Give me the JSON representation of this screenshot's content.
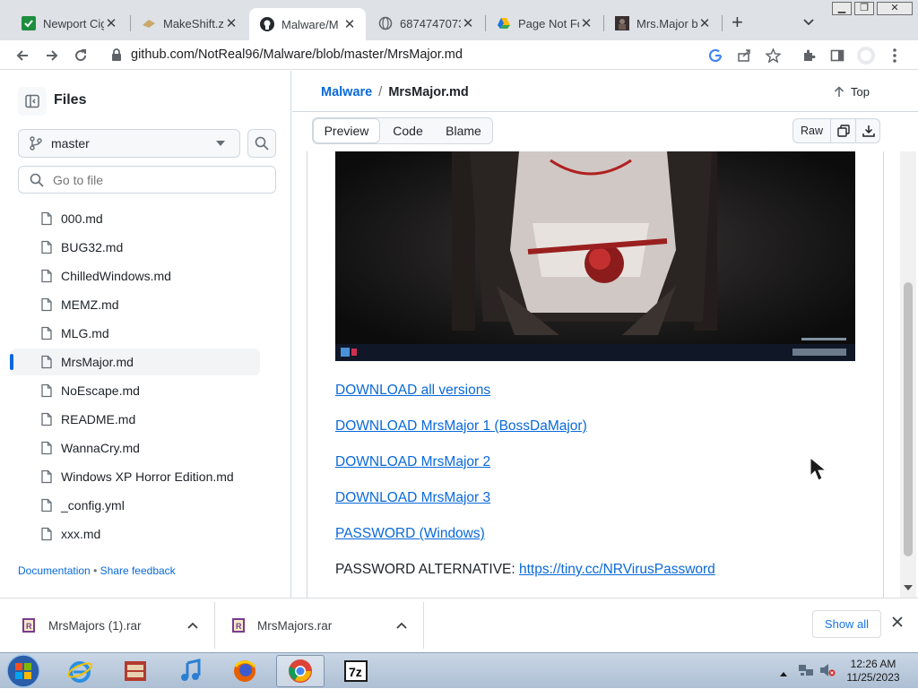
{
  "browser": {
    "tabs": [
      {
        "title": "Newport Cig",
        "favicon": "newport-favicon"
      },
      {
        "title": "MakeShift.zi",
        "favicon": "makeshift-favicon"
      },
      {
        "title": "Malware/M",
        "favicon": "github-favicon",
        "active": true
      },
      {
        "title": "6874747073",
        "favicon": "globe-favicon"
      },
      {
        "title": "Page Not Fo",
        "favicon": "drive-favicon"
      },
      {
        "title": "Mrs.Major b",
        "favicon": "image-favicon"
      }
    ],
    "new_tab_label": "+",
    "url": "github.com/NotReal96/Malware/blob/master/MrsMajor.md"
  },
  "sidebar": {
    "title": "Files",
    "branch": "master",
    "goto_placeholder": "Go to file",
    "files": [
      {
        "name": "000.md"
      },
      {
        "name": "BUG32.md"
      },
      {
        "name": "ChilledWindows.md"
      },
      {
        "name": "MEMZ.md"
      },
      {
        "name": "MLG.md"
      },
      {
        "name": "MrsMajor.md",
        "selected": true
      },
      {
        "name": "NoEscape.md"
      },
      {
        "name": "README.md"
      },
      {
        "name": "WannaCry.md"
      },
      {
        "name": "Windows XP Horror Edition.md"
      },
      {
        "name": "_config.yml"
      },
      {
        "name": "xxx.md"
      }
    ],
    "footer": {
      "documentation": "Documentation",
      "separator": "•",
      "feedback": "Share feedback"
    }
  },
  "main": {
    "breadcrumb": {
      "repo": "Malware",
      "separator": "/",
      "file": "MrsMajor.md"
    },
    "top_label": "Top",
    "view_tabs": [
      "Preview",
      "Code",
      "Blame"
    ],
    "active_view": "Preview",
    "raw_label": "Raw",
    "links": [
      "DOWNLOAD all versions",
      "DOWNLOAD MrsMajor 1 (BossDaMajor)",
      "DOWNLOAD MrsMajor 2",
      "DOWNLOAD MrsMajor 3",
      "PASSWORD (Windows)"
    ],
    "password_alt": {
      "label": "PASSWORD ALTERNATIVE:",
      "link": "https://tiny.cc/NRVirusPassword"
    }
  },
  "downloads": {
    "items": [
      "MrsMajors (1).rar",
      "MrsMajors.rar"
    ],
    "show_all": "Show all"
  },
  "taskbar": {
    "time": "12:26 AM",
    "date": "11/25/2023",
    "apps": [
      "start-orb",
      "internet-explorer",
      "media-center",
      "itunes",
      "firefox",
      "chrome",
      "7zip"
    ]
  },
  "colors": {
    "accent": "#0969da",
    "chrome_tab_bg": "#dee1e6"
  }
}
